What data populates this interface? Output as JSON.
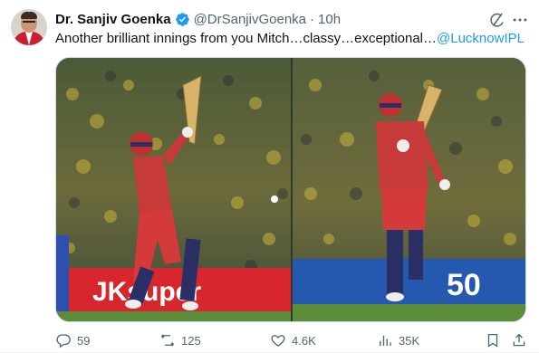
{
  "tweet": {
    "author_name": "Dr. Sanjiv Goenka",
    "handle": "@DrSanjivGoenka",
    "separator": "·",
    "time": "10h",
    "text": "Another brilliant innings from you Mitch…classy…exceptional…",
    "mention": "@LucknowIPL"
  },
  "media": {
    "left_banner_text": "JKsuper",
    "right_banner_text": "50"
  },
  "actions": {
    "replies": "59",
    "retweets": "125",
    "likes": "4.6K",
    "views": "35K"
  },
  "colors": {
    "accent": "#1d9bf0",
    "secondary_text": "#536471",
    "primary_text": "#0f1419"
  },
  "icons": [
    "verified-icon",
    "grok-icon",
    "more-icon",
    "reply-icon",
    "retweet-icon",
    "like-icon",
    "views-icon",
    "bookmark-icon",
    "share-icon"
  ]
}
